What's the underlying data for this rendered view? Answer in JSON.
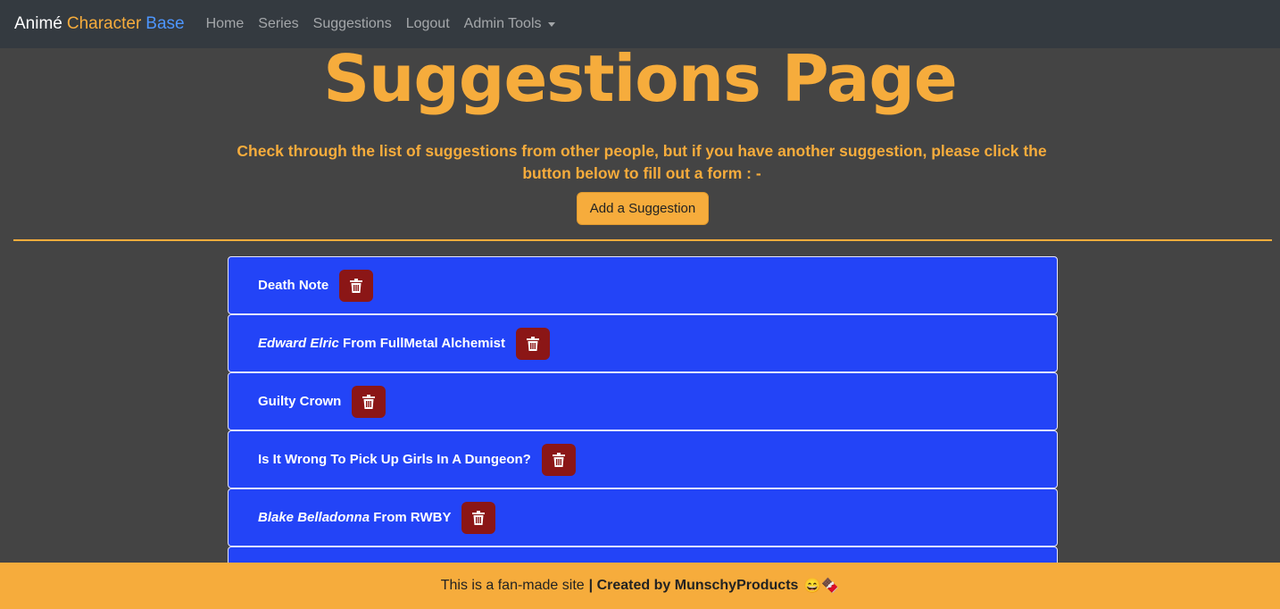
{
  "nav": {
    "brand_1": "Animé",
    "brand_2": "Character",
    "brand_3": "Base",
    "links": [
      "Home",
      "Series",
      "Suggestions",
      "Logout",
      "Admin Tools"
    ]
  },
  "main": {
    "title": "Suggestions Page",
    "intro": "Check through the list of suggestions from other people, but if you have another suggestion, please click the button below to fill out a form : -",
    "add_button": "Add a Suggestion"
  },
  "suggestions": [
    {
      "italic": "",
      "text": "Death Note"
    },
    {
      "italic": "Edward Elric",
      "text": "From FullMetal Alchemist"
    },
    {
      "italic": "",
      "text": "Guilty Crown"
    },
    {
      "italic": "",
      "text": "Is It Wrong To Pick Up Girls In A Dungeon?"
    },
    {
      "italic": "Blake Belladonna",
      "text": "From RWBY"
    }
  ],
  "footer": {
    "text": "This is a fan-made site",
    "bold": "| Created by MunschyProducts",
    "emoji": "😄🍫"
  },
  "colors": {
    "accent": "#f6ac3c",
    "navbar": "#343a40",
    "list_item": "#2344f7",
    "delete": "#8b1616",
    "background": "#444444"
  },
  "icons": {
    "delete": "trash-icon",
    "dropdown": "caret-down-icon"
  }
}
